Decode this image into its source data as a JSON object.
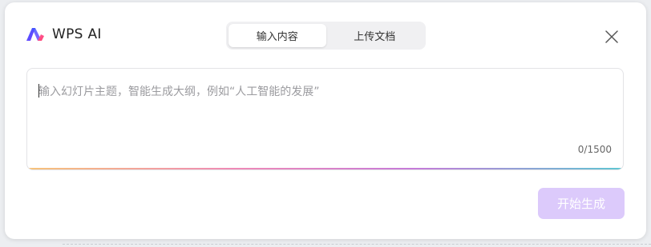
{
  "brand": {
    "name": "WPS AI",
    "icon": "wps-ai-logo"
  },
  "tabs": [
    {
      "label": "输入内容",
      "active": true
    },
    {
      "label": "上传文档",
      "active": false
    }
  ],
  "close": {
    "icon": "close-icon"
  },
  "prompt": {
    "value": "",
    "placeholder": "输入幻灯片主题，智能生成大纲，例如“人工智能的发展”",
    "counter": "0/1500"
  },
  "actions": {
    "generate_label": "开始生成"
  },
  "colors": {
    "accent_disabled": "#dccafb",
    "gradient": [
      "#f6c37a",
      "#ef8ab7",
      "#c57bd9",
      "#5ec6d2"
    ]
  }
}
